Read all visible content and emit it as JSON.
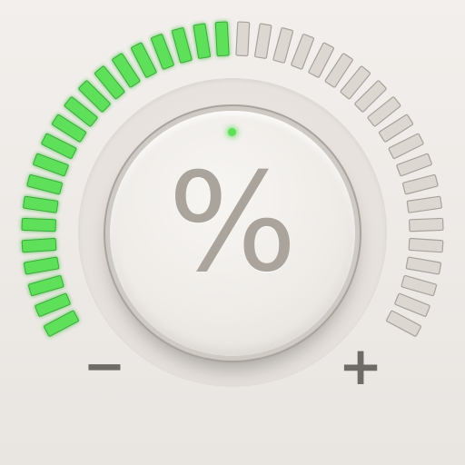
{
  "control": {
    "symbol": "%",
    "decrease_label": "−",
    "increase_label": "+"
  },
  "gauge": {
    "total_segments": 40,
    "active_segments": 20,
    "level_fraction": 0.5,
    "active_color": "#5ee05a",
    "inactive_color": "#dcd7d1"
  },
  "indicator": {
    "color": "#5fe05a"
  }
}
